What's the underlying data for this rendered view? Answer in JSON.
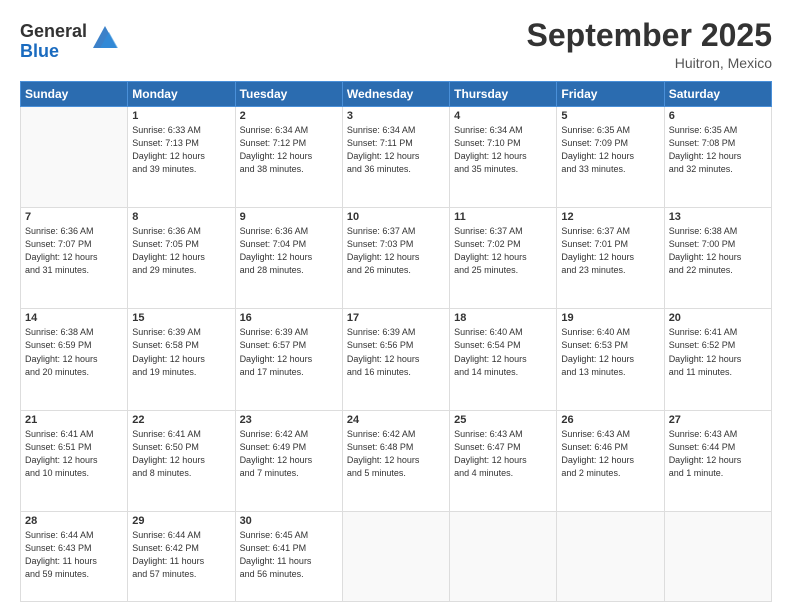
{
  "header": {
    "logo_line1": "General",
    "logo_line2": "Blue",
    "month": "September 2025",
    "location": "Huitron, Mexico"
  },
  "days_of_week": [
    "Sunday",
    "Monday",
    "Tuesday",
    "Wednesday",
    "Thursday",
    "Friday",
    "Saturday"
  ],
  "weeks": [
    [
      {
        "day": "",
        "info": ""
      },
      {
        "day": "1",
        "info": "Sunrise: 6:33 AM\nSunset: 7:13 PM\nDaylight: 12 hours\nand 39 minutes."
      },
      {
        "day": "2",
        "info": "Sunrise: 6:34 AM\nSunset: 7:12 PM\nDaylight: 12 hours\nand 38 minutes."
      },
      {
        "day": "3",
        "info": "Sunrise: 6:34 AM\nSunset: 7:11 PM\nDaylight: 12 hours\nand 36 minutes."
      },
      {
        "day": "4",
        "info": "Sunrise: 6:34 AM\nSunset: 7:10 PM\nDaylight: 12 hours\nand 35 minutes."
      },
      {
        "day": "5",
        "info": "Sunrise: 6:35 AM\nSunset: 7:09 PM\nDaylight: 12 hours\nand 33 minutes."
      },
      {
        "day": "6",
        "info": "Sunrise: 6:35 AM\nSunset: 7:08 PM\nDaylight: 12 hours\nand 32 minutes."
      }
    ],
    [
      {
        "day": "7",
        "info": "Sunrise: 6:36 AM\nSunset: 7:07 PM\nDaylight: 12 hours\nand 31 minutes."
      },
      {
        "day": "8",
        "info": "Sunrise: 6:36 AM\nSunset: 7:05 PM\nDaylight: 12 hours\nand 29 minutes."
      },
      {
        "day": "9",
        "info": "Sunrise: 6:36 AM\nSunset: 7:04 PM\nDaylight: 12 hours\nand 28 minutes."
      },
      {
        "day": "10",
        "info": "Sunrise: 6:37 AM\nSunset: 7:03 PM\nDaylight: 12 hours\nand 26 minutes."
      },
      {
        "day": "11",
        "info": "Sunrise: 6:37 AM\nSunset: 7:02 PM\nDaylight: 12 hours\nand 25 minutes."
      },
      {
        "day": "12",
        "info": "Sunrise: 6:37 AM\nSunset: 7:01 PM\nDaylight: 12 hours\nand 23 minutes."
      },
      {
        "day": "13",
        "info": "Sunrise: 6:38 AM\nSunset: 7:00 PM\nDaylight: 12 hours\nand 22 minutes."
      }
    ],
    [
      {
        "day": "14",
        "info": "Sunrise: 6:38 AM\nSunset: 6:59 PM\nDaylight: 12 hours\nand 20 minutes."
      },
      {
        "day": "15",
        "info": "Sunrise: 6:39 AM\nSunset: 6:58 PM\nDaylight: 12 hours\nand 19 minutes."
      },
      {
        "day": "16",
        "info": "Sunrise: 6:39 AM\nSunset: 6:57 PM\nDaylight: 12 hours\nand 17 minutes."
      },
      {
        "day": "17",
        "info": "Sunrise: 6:39 AM\nSunset: 6:56 PM\nDaylight: 12 hours\nand 16 minutes."
      },
      {
        "day": "18",
        "info": "Sunrise: 6:40 AM\nSunset: 6:54 PM\nDaylight: 12 hours\nand 14 minutes."
      },
      {
        "day": "19",
        "info": "Sunrise: 6:40 AM\nSunset: 6:53 PM\nDaylight: 12 hours\nand 13 minutes."
      },
      {
        "day": "20",
        "info": "Sunrise: 6:41 AM\nSunset: 6:52 PM\nDaylight: 12 hours\nand 11 minutes."
      }
    ],
    [
      {
        "day": "21",
        "info": "Sunrise: 6:41 AM\nSunset: 6:51 PM\nDaylight: 12 hours\nand 10 minutes."
      },
      {
        "day": "22",
        "info": "Sunrise: 6:41 AM\nSunset: 6:50 PM\nDaylight: 12 hours\nand 8 minutes."
      },
      {
        "day": "23",
        "info": "Sunrise: 6:42 AM\nSunset: 6:49 PM\nDaylight: 12 hours\nand 7 minutes."
      },
      {
        "day": "24",
        "info": "Sunrise: 6:42 AM\nSunset: 6:48 PM\nDaylight: 12 hours\nand 5 minutes."
      },
      {
        "day": "25",
        "info": "Sunrise: 6:43 AM\nSunset: 6:47 PM\nDaylight: 12 hours\nand 4 minutes."
      },
      {
        "day": "26",
        "info": "Sunrise: 6:43 AM\nSunset: 6:46 PM\nDaylight: 12 hours\nand 2 minutes."
      },
      {
        "day": "27",
        "info": "Sunrise: 6:43 AM\nSunset: 6:44 PM\nDaylight: 12 hours\nand 1 minute."
      }
    ],
    [
      {
        "day": "28",
        "info": "Sunrise: 6:44 AM\nSunset: 6:43 PM\nDaylight: 11 hours\nand 59 minutes."
      },
      {
        "day": "29",
        "info": "Sunrise: 6:44 AM\nSunset: 6:42 PM\nDaylight: 11 hours\nand 57 minutes."
      },
      {
        "day": "30",
        "info": "Sunrise: 6:45 AM\nSunset: 6:41 PM\nDaylight: 11 hours\nand 56 minutes."
      },
      {
        "day": "",
        "info": ""
      },
      {
        "day": "",
        "info": ""
      },
      {
        "day": "",
        "info": ""
      },
      {
        "day": "",
        "info": ""
      }
    ]
  ]
}
